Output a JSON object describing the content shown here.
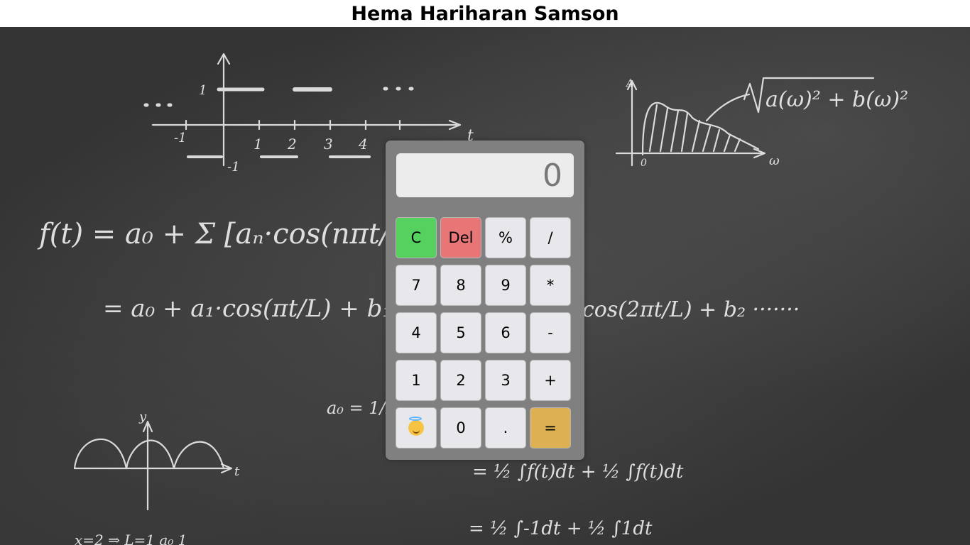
{
  "page": {
    "title": "Hema Hariharan Samson"
  },
  "background": {
    "description": "chalkboard with handwritten Fourier series equations and graphs"
  },
  "calculator": {
    "display_value": "0",
    "colors": {
      "body": "#808080",
      "display": "#ececec",
      "clear": "#55d160",
      "delete": "#e87676",
      "equals": "#ddb054",
      "key": "#e8e8ec"
    },
    "keys": {
      "clear": "C",
      "delete": "Del",
      "percent": "%",
      "divide": "/",
      "seven": "7",
      "eight": "8",
      "nine": "9",
      "multiply": "*",
      "four": "4",
      "five": "5",
      "six": "6",
      "subtract": "-",
      "one": "1",
      "two": "2",
      "three": "3",
      "add": "+",
      "emoji_icon": "smiling-face-with-halo-icon",
      "zero": "0",
      "decimal": ".",
      "equals": "="
    }
  }
}
